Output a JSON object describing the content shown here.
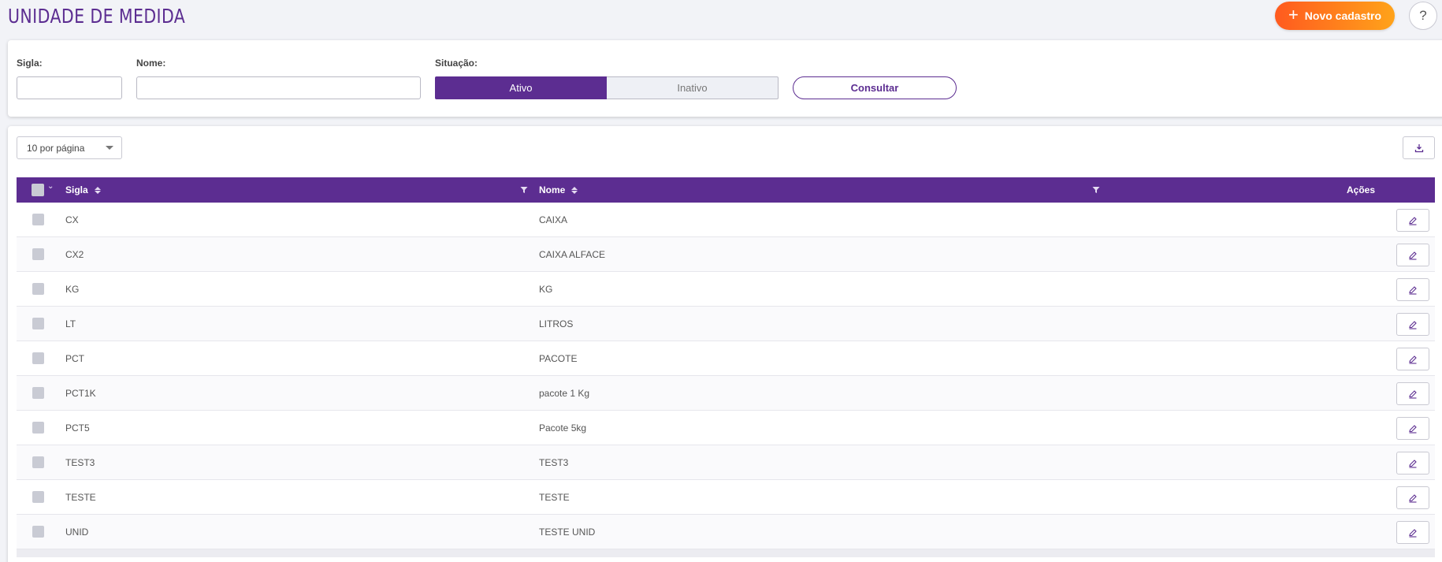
{
  "header": {
    "title": "UNIDADE DE MEDIDA",
    "new_button_label": "Novo cadastro",
    "help_label": "?"
  },
  "filters": {
    "sigla_label": "Sigla:",
    "sigla_value": "",
    "nome_label": "Nome:",
    "nome_value": "",
    "situacao_label": "Situação:",
    "situacao_options": [
      "Ativo",
      "Inativo"
    ],
    "situacao_selected": "Ativo",
    "consult_label": "Consultar"
  },
  "list": {
    "page_size_label": "10 por página",
    "columns": {
      "sigla": "Sigla",
      "nome": "Nome",
      "acoes": "Ações"
    },
    "rows": [
      {
        "sigla": "CX",
        "nome": "CAIXA"
      },
      {
        "sigla": "CX2",
        "nome": "CAIXA ALFACE"
      },
      {
        "sigla": "KG",
        "nome": "KG"
      },
      {
        "sigla": "LT",
        "nome": "LITROS"
      },
      {
        "sigla": "PCT",
        "nome": "PACOTE"
      },
      {
        "sigla": "PCT1K",
        "nome": "pacote 1 Kg"
      },
      {
        "sigla": "PCT5",
        "nome": "Pacote 5kg"
      },
      {
        "sigla": "TEST3",
        "nome": "TEST3"
      },
      {
        "sigla": "TESTE",
        "nome": "TESTE"
      },
      {
        "sigla": "UNID",
        "nome": "TESTE UNID"
      }
    ]
  },
  "colors": {
    "primary": "#5c2d91",
    "accent_start": "#ff5a1f",
    "accent_end": "#ffa31a",
    "background": "#f2f3f7"
  },
  "icons": {
    "new": "plus-icon",
    "help": "question-icon",
    "export": "download-icon",
    "sort": "sort-icon",
    "filter": "filter-icon",
    "edit": "pencil-icon",
    "select_all_caret": "chevron-down-icon"
  }
}
